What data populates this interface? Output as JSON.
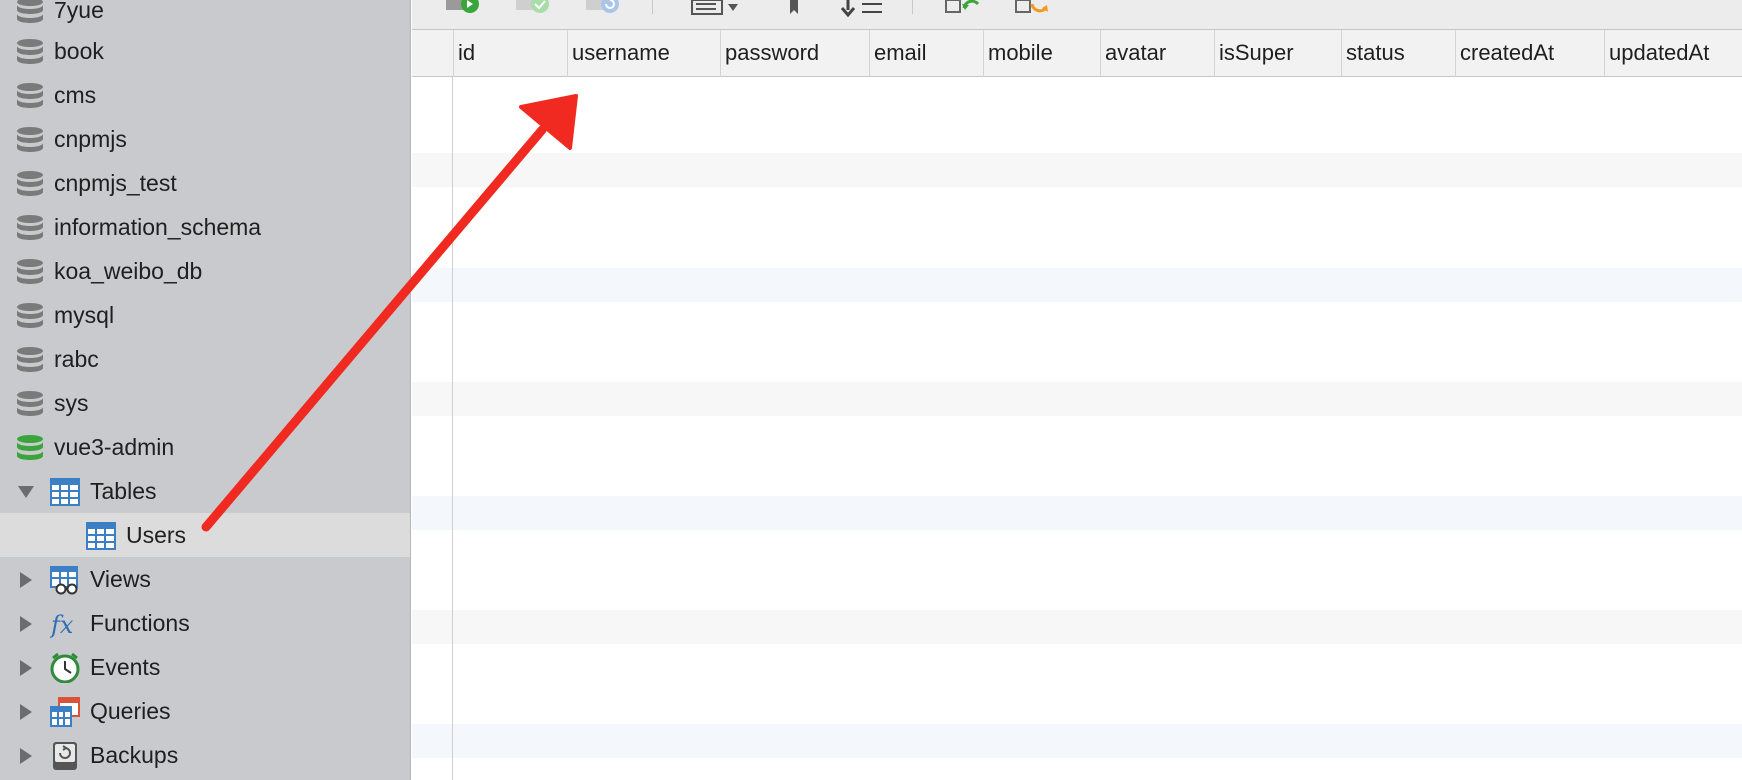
{
  "sidebar": {
    "databases": [
      {
        "label": "7yue"
      },
      {
        "label": "book"
      },
      {
        "label": "cms"
      },
      {
        "label": "cnpmjs"
      },
      {
        "label": "cnpmjs_test"
      },
      {
        "label": "information_schema"
      },
      {
        "label": "koa_weibo_db"
      },
      {
        "label": "mysql"
      },
      {
        "label": "rabc"
      },
      {
        "label": "sys"
      },
      {
        "label": "vue3-admin"
      }
    ],
    "groups": [
      {
        "label": "Tables",
        "expanded": true
      },
      {
        "label": "Users",
        "selected": true
      },
      {
        "label": "Views"
      },
      {
        "label": "Functions"
      },
      {
        "label": "Events"
      },
      {
        "label": "Queries"
      },
      {
        "label": "Backups"
      }
    ]
  },
  "grid": {
    "columns": [
      "id",
      "username",
      "password",
      "email",
      "mobile",
      "avatar",
      "isSuper",
      "status",
      "createdAt",
      "updatedAt"
    ]
  },
  "colors": {
    "active_db_icon": "#3aa53a",
    "db_icon": "#7a7a7a",
    "annotation_arrow": "#f02a20",
    "table_icon": "#3b7fc4"
  }
}
